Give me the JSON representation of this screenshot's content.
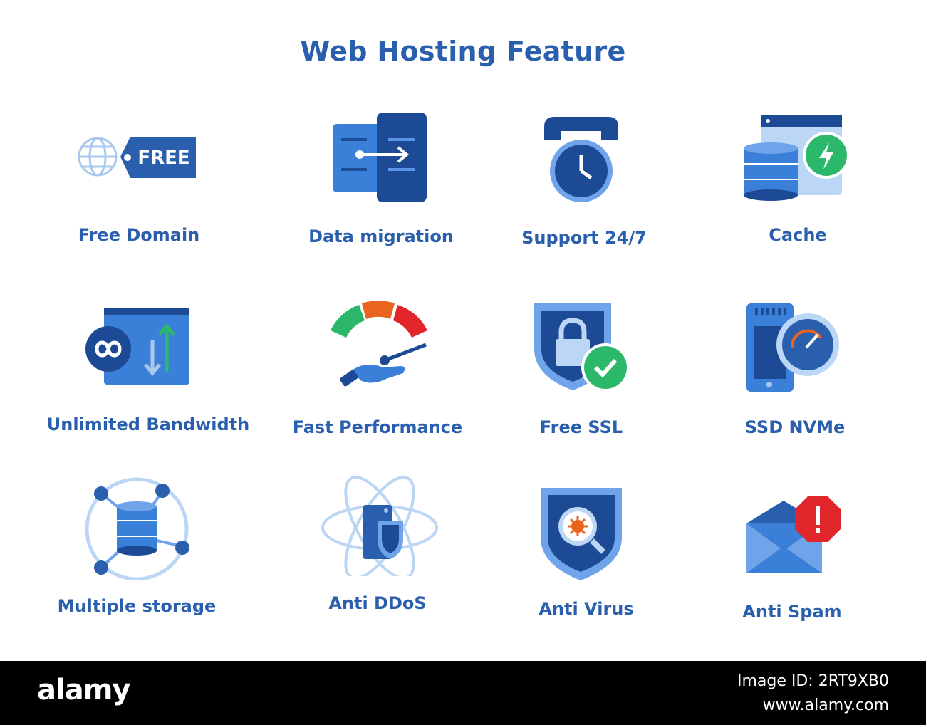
{
  "title": "Web Hosting Feature",
  "colors": {
    "primary": "#2a5fad",
    "dark": "#1d4a95",
    "light": "#a9c8ee",
    "green": "#2cb86a",
    "orange": "#e9641e",
    "red": "#e0262b"
  },
  "features": [
    {
      "label": "Free Domain",
      "icon": "globe-tag-icon",
      "badge": "FREE"
    },
    {
      "label": "Data migration",
      "icon": "data-migration-icon"
    },
    {
      "label": "Support 24/7",
      "icon": "phone-clock-icon"
    },
    {
      "label": "Cache",
      "icon": "database-lightning-icon"
    },
    {
      "label": "Unlimited Bandwidth",
      "icon": "infinity-arrows-icon"
    },
    {
      "label": "Fast Performance",
      "icon": "speedometer-hand-icon"
    },
    {
      "label": "Free SSL",
      "icon": "shield-lock-check-icon"
    },
    {
      "label": "SSD NVMe",
      "icon": "ssd-gauge-icon"
    },
    {
      "label": "Multiple storage",
      "icon": "database-network-icon"
    },
    {
      "label": "Anti DDoS",
      "icon": "atom-server-shield-icon"
    },
    {
      "label": "Anti Virus",
      "icon": "shield-virus-search-icon"
    },
    {
      "label": "Anti Spam",
      "icon": "envelope-warning-icon"
    }
  ],
  "footer": {
    "brand": "alamy",
    "image_id_label": "Image ID: 2RT9XB0",
    "site": "www.alamy.com"
  }
}
